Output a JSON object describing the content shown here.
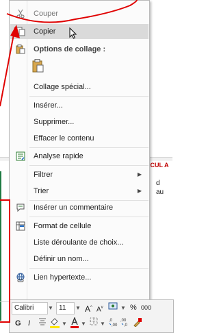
{
  "sheet": {
    "header_text": "LCUL A",
    "line1": "d",
    "line2": "au"
  },
  "menu": {
    "items": [
      {
        "label": "Couper",
        "icon": "scissors-icon",
        "state": "disabled"
      },
      {
        "label": "Copier",
        "icon": "copy-icon",
        "state": "highlighted"
      },
      {
        "label": "Options de collage :",
        "icon": "paste-icon"
      },
      {
        "label": "Collage spécial..."
      },
      {
        "label": "Insérer..."
      },
      {
        "label": "Supprimer..."
      },
      {
        "label": "Effacer le contenu"
      },
      {
        "label": "Analyse rapide",
        "icon": "quick-analysis-icon"
      },
      {
        "label": "Filtrer",
        "submenu": true
      },
      {
        "label": "Trier",
        "submenu": true
      },
      {
        "label": "Insérer un commentaire",
        "icon": "comment-icon"
      },
      {
        "label": "Format de cellule",
        "icon": "format-cells-icon"
      },
      {
        "label": "Liste déroulante de choix..."
      },
      {
        "label": "Définir un nom..."
      },
      {
        "label": "Lien hypertexte...",
        "icon": "hyperlink-icon"
      }
    ]
  },
  "mini_toolbar": {
    "font_name": "Calibri",
    "font_size": "11",
    "grow_font": "A",
    "shrink_font": "A",
    "percent": "%",
    "thousands": "000",
    "bold": "G",
    "italic": "I"
  },
  "colors": {
    "highlight": "#dadada",
    "annotation_red": "#e00000",
    "fill_yellow": "#ffe600",
    "font_red": "#e00000"
  }
}
